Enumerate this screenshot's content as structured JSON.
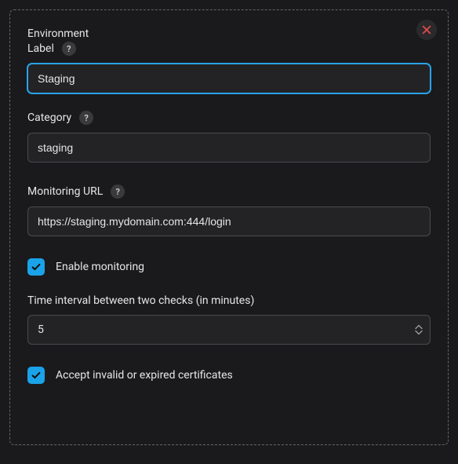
{
  "panel": {
    "title": "Environment",
    "close_icon": "close"
  },
  "fields": {
    "label": {
      "label": "Label",
      "help": "?",
      "value": "Staging"
    },
    "category": {
      "label": "Category",
      "help": "?",
      "value": "staging"
    },
    "monitoring_url": {
      "label": "Monitoring URL",
      "help": "?",
      "value": "https://staging.mydomain.com:444/login"
    },
    "enable_monitoring": {
      "label": "Enable monitoring",
      "checked": true
    },
    "interval": {
      "label": "Time interval between two checks (in minutes)",
      "value": "5"
    },
    "accept_invalid_cert": {
      "label": "Accept invalid or expired certificates",
      "checked": true
    }
  },
  "colors": {
    "accent": "#1aa3e8",
    "close": "#e24a4a",
    "bg": "#1a1a1c"
  }
}
